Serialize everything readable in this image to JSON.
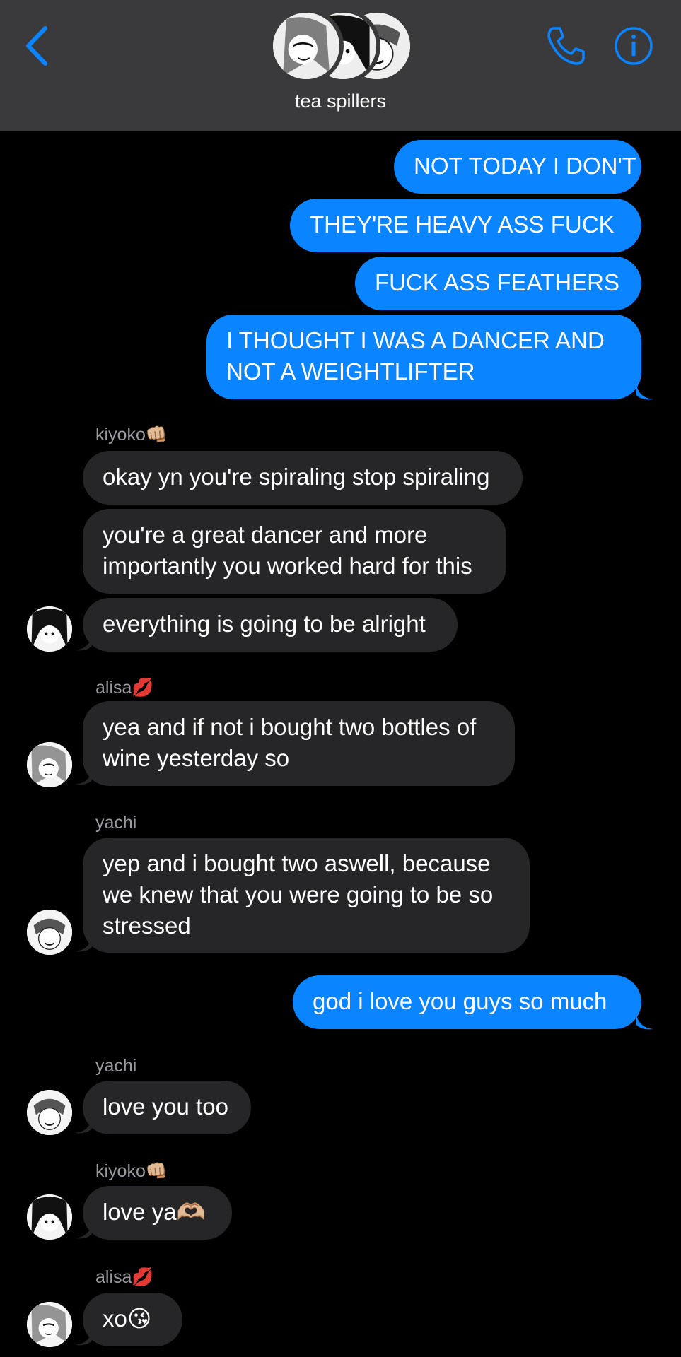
{
  "header": {
    "title": "tea spillers",
    "back_icon": "chevron-left-icon",
    "call_icon": "phone-icon",
    "info_icon": "info-icon",
    "accent": "#0a84ff"
  },
  "messages": {
    "m1": "NOT TODAY I DON'T",
    "m2": "THEY'RE HEAVY ASS FUCK",
    "m3": "FUCK ASS FEATHERS",
    "m4_line1": "I THOUGHT I WAS A DANCER AND",
    "m4_line2": "NOT A WEIGHTLIFTER",
    "kiyoko_sender": "kiyoko",
    "kiyoko_emoji": "👊🏼",
    "m5": "okay yn you're spiraling stop spiraling",
    "m6_line1": "you're a great dancer and more",
    "m6_line2": "importantly you worked hard for this",
    "m7": "everything is going to be alright",
    "alisa_sender": "alisa",
    "alisa_emoji": "💋",
    "m8_line1": "yea and if not i bought two bottles of",
    "m8_line2": "wine yesterday so",
    "yachi_sender": "yachi",
    "m9_line1": "yep and i bought two aswell, because",
    "m9_line2": "we knew that you were going to be so",
    "m9_line3": "stressed",
    "m10": "god i love you guys so much",
    "yachi_sender_2": "yachi",
    "m11": "love you too",
    "kiyoko_sender_2": "kiyoko",
    "kiyoko_emoji_2": "👊🏼",
    "m12": "love ya",
    "m12_emoji": "🫶🏼",
    "alisa_sender_2": "alisa",
    "alisa_emoji_2": "💋",
    "m13": "xo",
    "m13_emoji": "😘"
  },
  "colors": {
    "outgoing_bubble": "#0a84ff",
    "incoming_bubble": "#262628",
    "header_bg": "#3a3a3c",
    "sender_name": "#9a9aa0"
  }
}
